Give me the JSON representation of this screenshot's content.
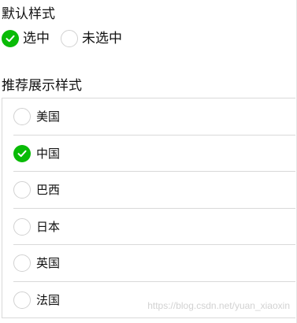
{
  "default_section": {
    "title": "默认样式",
    "options": [
      {
        "label": "选中",
        "checked": true
      },
      {
        "label": "未选中",
        "checked": false
      }
    ]
  },
  "recommended_section": {
    "title": "推荐展示样式",
    "items": [
      {
        "label": "美国",
        "checked": false
      },
      {
        "label": "中国",
        "checked": true
      },
      {
        "label": "巴西",
        "checked": false
      },
      {
        "label": "日本",
        "checked": false
      },
      {
        "label": "英国",
        "checked": false
      },
      {
        "label": "法国",
        "checked": false
      }
    ]
  },
  "watermark": "https://blog.csdn.net/yuan_xiaoxin",
  "colors": {
    "checked": "#09bb07",
    "unchecked_border": "#d1d1d1",
    "divider": "#d9d9d9"
  },
  "icons": {
    "checked": "check-icon"
  }
}
